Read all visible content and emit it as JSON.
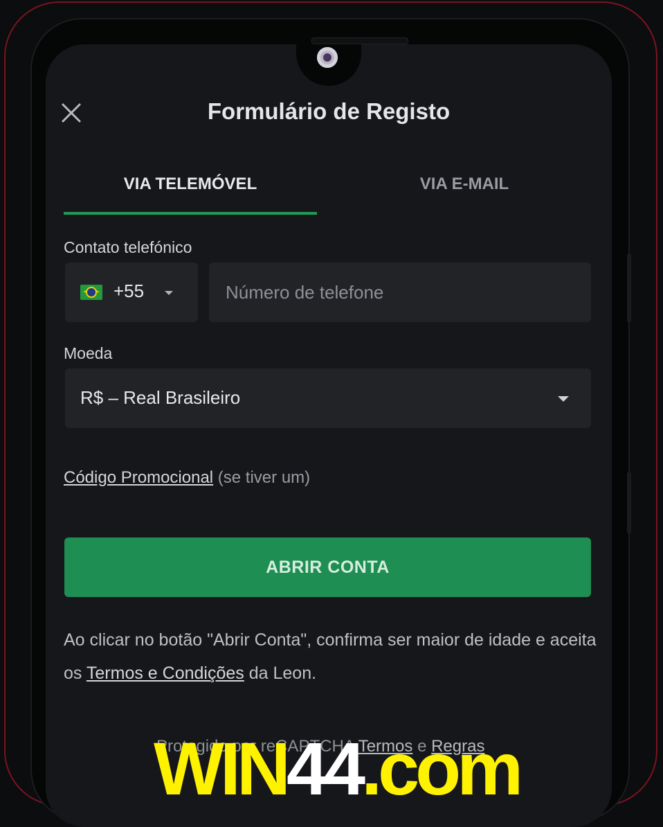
{
  "header": {
    "title": "Formulário de Registo",
    "close_icon": "close-icon"
  },
  "tabs": [
    {
      "label": "VIA TELEMÓVEL",
      "active": true
    },
    {
      "label": "VIA E-MAIL",
      "active": false
    }
  ],
  "phone": {
    "label": "Contato telefónico",
    "country_code": "+55",
    "flag_icon": "brazil-flag-icon",
    "value": "",
    "placeholder": "Número de telefone"
  },
  "currency": {
    "label": "Moeda",
    "selected": "R$ – Real Brasileiro"
  },
  "promo": {
    "link": "Código Promocional",
    "suffix": "(se tiver um)"
  },
  "submit": {
    "label": "ABRIR CONTA"
  },
  "terms": {
    "prefix": "Ao clicar no botão \"Abrir Conta\", confirma ser maior de idade e aceita os",
    "link": "Termos e Condições",
    "suffix": "da Leon."
  },
  "captcha": {
    "prefix": "Protegido por reCAPTCHA",
    "terms_link": "Termos",
    "and": "e",
    "rules_link": "Regras"
  },
  "watermark": {
    "part1": "WIN",
    "part2": "44",
    "part3": ".com"
  },
  "colors": {
    "accent_green": "#1e8e53",
    "background": "#16171a",
    "field_bg": "#222327",
    "frame_red": "#7a1420",
    "watermark_yellow": "#fff200"
  }
}
